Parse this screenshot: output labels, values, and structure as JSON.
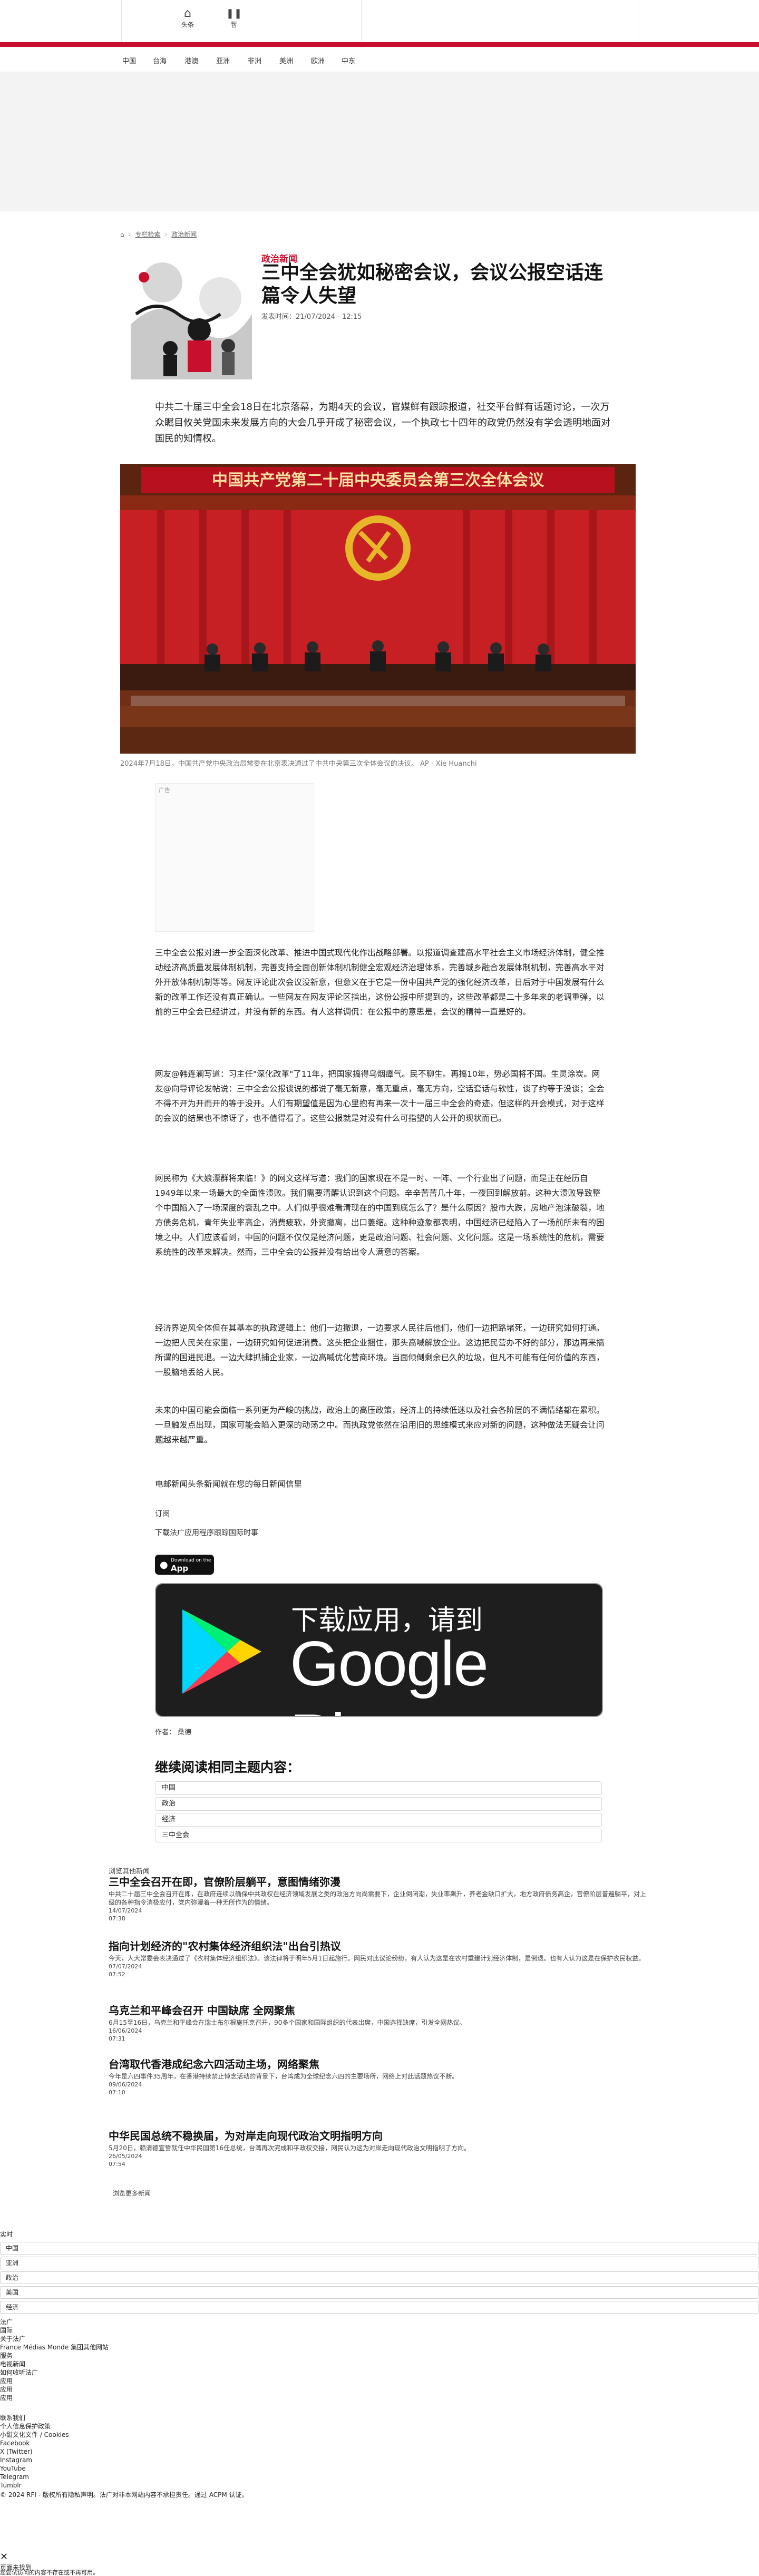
{
  "top_tabs": [
    {
      "label": "头条",
      "icon": "home-icon"
    },
    {
      "label": "暂",
      "icon": "pause-icon"
    }
  ],
  "nav": [
    "中国",
    "台海",
    "港澳",
    "亚洲",
    "非洲",
    "美洲",
    "欧洲",
    "中东"
  ],
  "colors": {
    "brand_red": "#c8102e",
    "dark": "#1e1e1e"
  },
  "breadcrumb": [
    "⌂",
    "专栏检索",
    "政治新闻"
  ],
  "article": {
    "kicker": "政治新闻",
    "title": "三中全会犹如秘密会议，会议公报空话连篇令人失望",
    "pubdate": "发表时间：21/07/2024 - 12:15",
    "lead": "中共二十届三中全会18日在北京落幕，为期4天的会议，官媒鲜有跟踪报道，社交平台鲜有话题讨论，一次万众瞩目攸关党国未来发展方向的大会几乎开成了秘密会议，一个执政七十四年的政党仍然没有学会透明地面对国民的知情权。",
    "photo_banner": "中国共产党第二十届中央委员会第三次全体会议",
    "caption": "2024年7月18日，中国共产党中央政治局常委在北京表决通过了中共中央第三次全体会议的决议。 AP - Xie Huanchi",
    "ad_label": "广告",
    "paragraphs": [
      "三中全会公报对进一步全面深化改革、推进中国式现代化作出战略部署。以报道调查建高水平社会主义市场经济体制，健全推动经济高质量发展体制机制，完善支持全面创新体制机制健全宏观经济治理体系，完善城乡融合发展体制机制，完善高水平对外开放体制机制等等。网友评论此次会议没新意，但意义在于它是一份中国共产党的强化经济改革，日后对于中国发展有什么新的改革工作还没有真正确认。一些网友在网友评论区指出，这份公报中所提到的，这些改革都是二十多年来的老调重弹，以前的三中全会已经讲过，并没有新的东西。有人这样调侃：在公报中的意思是，会议的精神一直是好的。",
      "网友@韩连澜写道：习主任\"深化改革\"了11年，把国家搞得乌烟瘴气。民不聊生。再搞10年，势必国将不国。生灵涂炭。网友@向导评论发帖说：三中全会公报谈说的都说了毫无新意，毫无重点，毫无方向，空话套话与软性，谈了约等于没谈；全会不得不开为开而开的等于没开。人们有期望值是因为心里抱有再来一次十一届三中全会的奇迹，但这样的开会模式，对于这样的会议的结果也不惊讶了，也不值得看了。这些公报就是对没有什么可指望的人公开的现状而已。",
      "网民称为《大娘漂群将来临！》的网文这样写道：我们的国家现在不是一时、一阵、一个行业出了问题，而是正在经历自1949年以来一场最大的全面性溃败。我们需要清醒认识到这个问题。辛辛苦苦几十年，一夜回到解放前。这种大溃败导致整个中国陷入了一场深度的衰乱之中。人们似乎很难看清现在的中国到底怎么了？是什么原因？股市大跌，房地产泡沫破裂，地方债务危机，青年失业率高企，消费疲软，外资撤离，出口萎缩。这种种迹象都表明，中国经济已经陷入了一场前所未有的困境之中。人们应该看到，中国的问题不仅仅是经济问题，更是政治问题、社会问题、文化问题。这是一场系统性的危机，需要系统性的改革来解决。然而，三中全会的公报并没有给出令人满意的答案。",
      "经济界逆风全体但在其基本的执政逻辑上：他们一边撤退，一边要求人民往后他们，他们一边把路堵死，一边研究如何打通。一边把人民关在家里，一边研究如何促进消费。这头把企业捆住，那头高喊解放企业。这边把民营办不好的部分，那边再来搞所谓的国进民退。一边大肆抓捕企业家，一边高喊优化营商环境。当面倾倒剩余已久的垃圾，但凡不可能有任何价值的东西，一股脑地丢给人民。",
      "未来的中国可能会面临一系列更为严峻的挑战，政治上的高压政策，经济上的持续低迷以及社会各阶层的不满情绪都在累积。一旦触发点出现，国家可能会陷入更深的动荡之中。而执政党依然在沿用旧的思维模式来应对新的问题，这种做法无疑会让问题越来越严重。",
      "电邮新闻头条新闻就在您的每日新闻信里"
    ],
    "follow": "订阅",
    "download_text": "下载法广应用程序跟踪国际时事",
    "appstore": {
      "sub": "Download on the",
      "main": "App Store"
    },
    "gplay": {
      "line1": "下载应用，请到",
      "line2": "Google Play"
    },
    "author": "作者： 桑德"
  },
  "related": {
    "heading": "继续阅读相同主题内容：",
    "tags": [
      "中国",
      "政治",
      "经济",
      "三中全会"
    ]
  },
  "latest": {
    "heading": "浏览其他新闻",
    "items": [
      {
        "title": "三中全会召开在即，官僚阶层躺平，意图情绪弥漫",
        "summary": "中共二十届三中全会召开在即，在政府连续以确保中共政权在经济领域发展之类的政治方向尚需要下，企业倒闭潮，失业率飙升，养老金缺口扩大，地方政府债务高企，官僚阶层普遍躺平，对上级的各种指令消极应付，党内弥漫着一种无所作为的情绪。",
        "date": "14/07/2024",
        "time": "07:38"
      },
      {
        "title": "指向计划经济的\"农村集体经济组织法\"出台引热议",
        "summary": "今天，人大常委会表决通过了《农村集体经济组织法》。该法律将于明年5月1日起施行。网民对此议论纷纷，有人认为这是在农村重建计划经济体制，是倒退。也有人认为这是在保护农民权益。",
        "date": "07/07/2024",
        "time": "07:52"
      },
      {
        "title": "乌克兰和平峰会召开 中国缺席 全网聚焦",
        "summary": "6月15至16日，乌克兰和平峰会在瑞士布尔根施托克召开，90多个国家和国际组织的代表出席，中国选择缺席，引发全网热议。",
        "date": "16/06/2024",
        "time": "07:31"
      },
      {
        "title": "台湾取代香港成纪念六四活动主场，网络聚焦",
        "summary": "今年是六四事件35周年，在香港持续禁止悼念活动的背景下，台湾成为全球纪念六四的主要场所，网络上对此话题热议不断。",
        "date": "09/06/2024",
        "time": "07:10"
      },
      {
        "title": "中华民国总统不稳换届，为对岸走向现代政治文明指明方向",
        "summary": "5月20日，赖清德宣誓就任中华民国第16任总统，台湾再次完成和平政权交接，网民认为这为对岸走向现代政治文明指明了方向。",
        "date": "26/05/2024",
        "time": "07:54"
      }
    ],
    "all": "浏览更多新闻"
  },
  "footer": {
    "lines_top": [
      "实时"
    ],
    "selects": [
      "中国",
      "亚洲",
      "政治",
      "美国",
      "经济"
    ],
    "lines_mid": [
      "法广",
      "国际",
      "关于法广",
      "France Médias Monde 集团其他网站",
      "服务",
      "电视新闻",
      "如何收听法广",
      "应用",
      "应用",
      "应用"
    ],
    "lines_bottom": [
      "联系我们",
      "个人信息保护政策",
      "小甜文化文件 / Cookies",
      "Facebook",
      "X (Twitter)",
      "Instagram",
      "YouTube",
      "Telegram",
      "Tumblr",
      "© 2024 RFI - 版权所有隐私声明。法广对非本网站内容不承担责任。通过 ACPM 认证。"
    ],
    "error_title": "页面未找到",
    "error_text": "您尝试访问的内容不存在或不再可用。"
  }
}
